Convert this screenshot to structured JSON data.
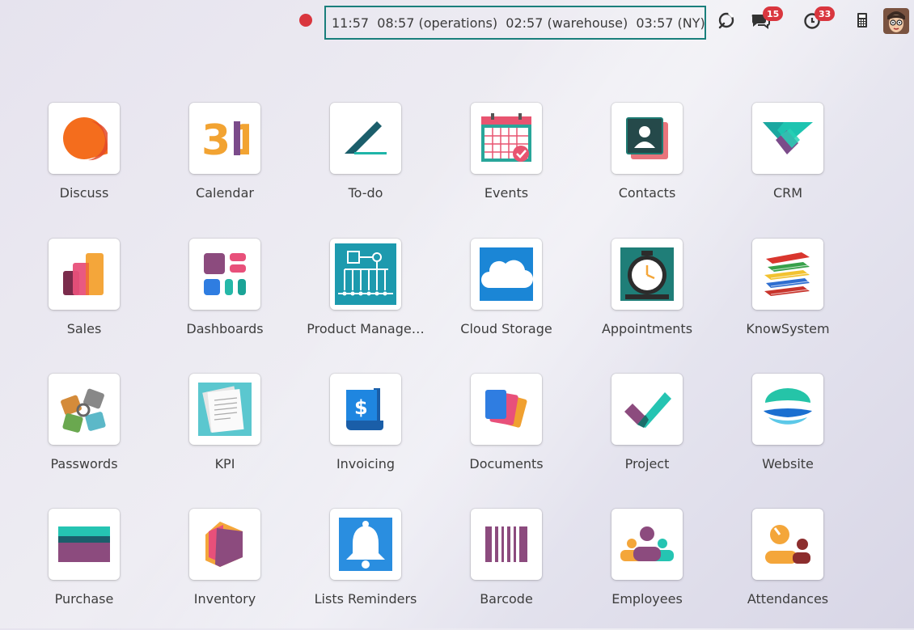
{
  "topbar": {
    "clock_text": "11:57  08:57 (operations)  02:57 (warehouse)  03:57 (NY)",
    "messages_badge": "15",
    "activities_badge": "33",
    "icons": [
      "record-dot",
      "refresh-icon",
      "chat-icon",
      "clock-icon",
      "phone-icon",
      "avatar"
    ]
  },
  "apps": [
    {
      "label": "Discuss"
    },
    {
      "label": "Calendar",
      "icon_text": "31"
    },
    {
      "label": "To-do"
    },
    {
      "label": "Events"
    },
    {
      "label": "Contacts"
    },
    {
      "label": "CRM"
    },
    {
      "label": "Sales"
    },
    {
      "label": "Dashboards"
    },
    {
      "label": "Product Manage…"
    },
    {
      "label": "Cloud Storage"
    },
    {
      "label": "Appointments"
    },
    {
      "label": "KnowSystem"
    },
    {
      "label": "Passwords"
    },
    {
      "label": "KPI"
    },
    {
      "label": "Invoicing",
      "icon_text": "$"
    },
    {
      "label": "Documents"
    },
    {
      "label": "Project"
    },
    {
      "label": "Website"
    },
    {
      "label": "Purchase"
    },
    {
      "label": "Inventory"
    },
    {
      "label": "Lists Reminders"
    },
    {
      "label": "Barcode"
    },
    {
      "label": "Employees"
    },
    {
      "label": "Attendances"
    }
  ]
}
